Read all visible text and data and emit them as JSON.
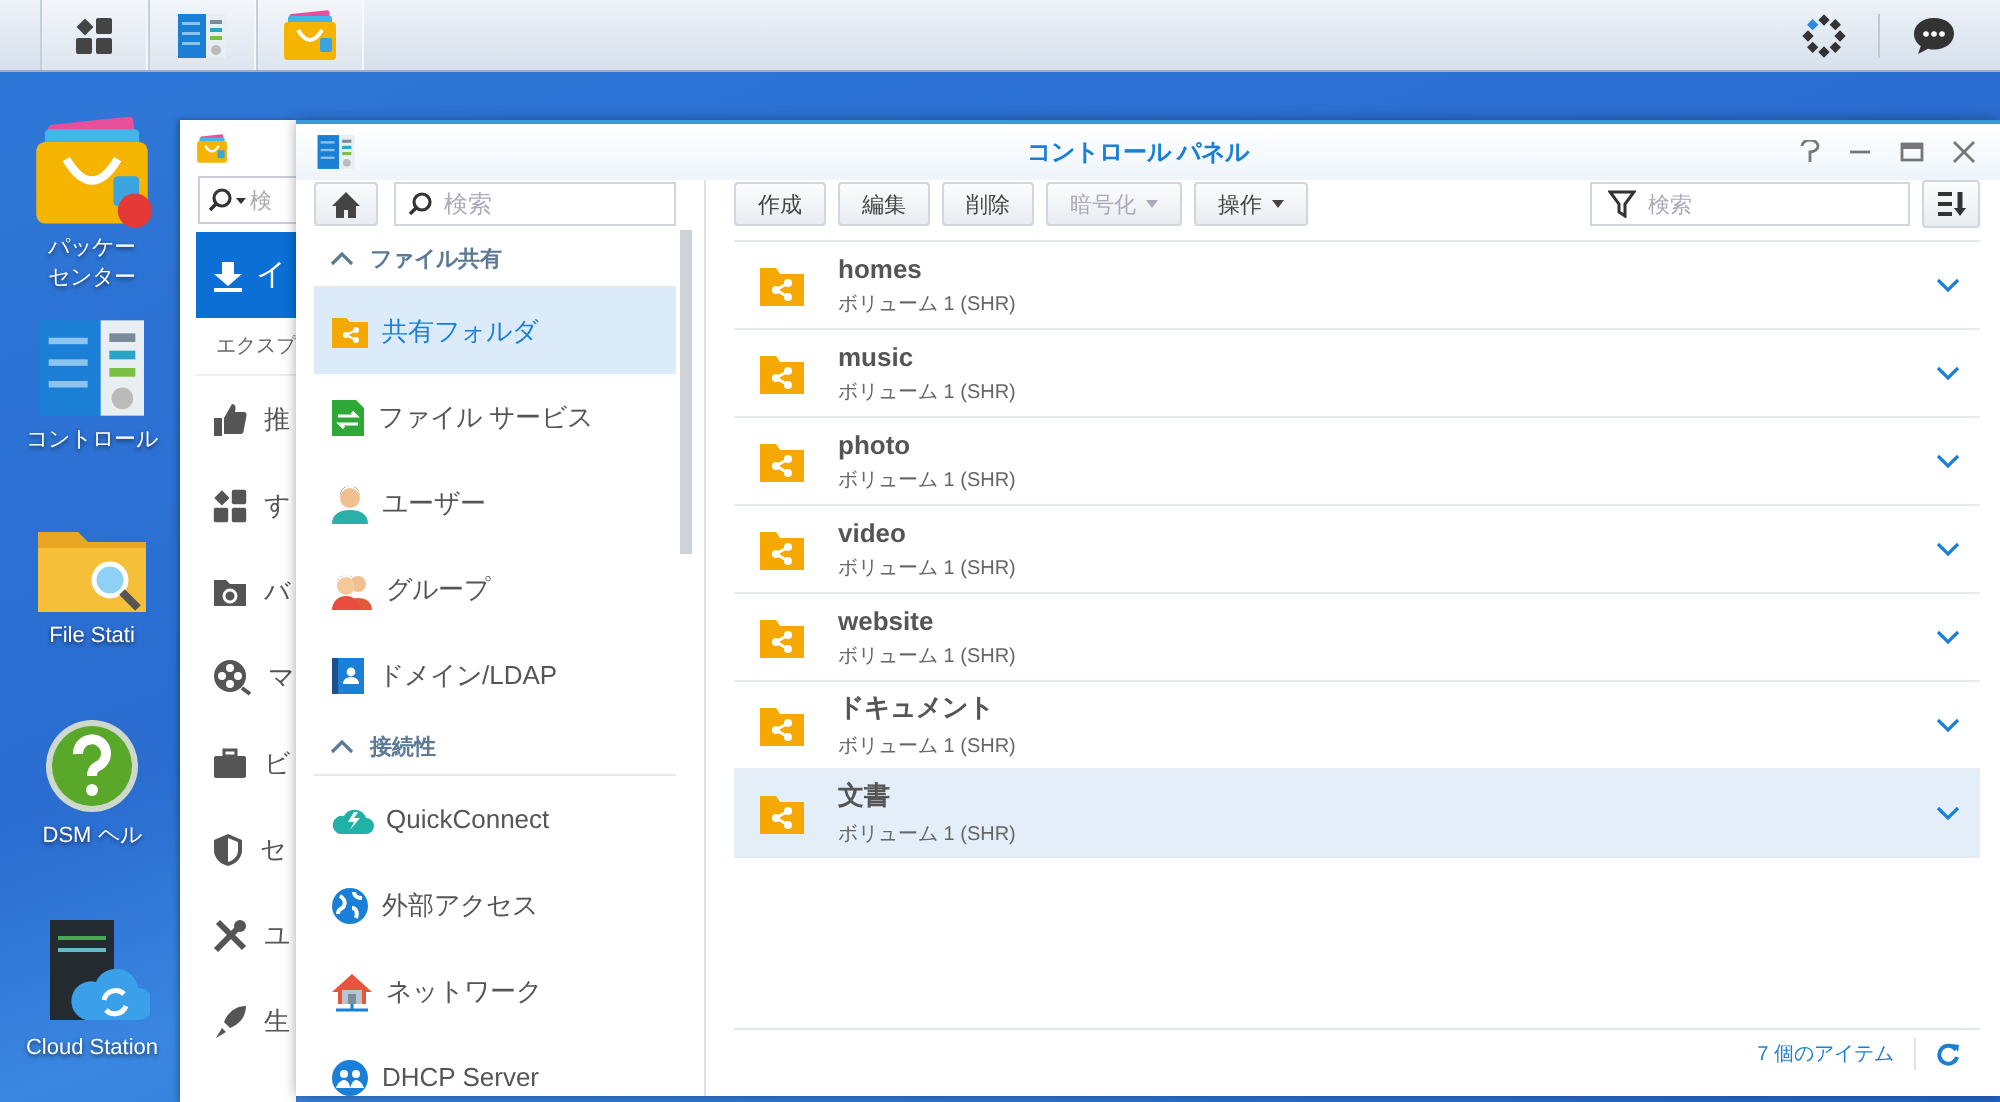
{
  "taskbar": {
    "apps": [
      {
        "kind": "main-menu"
      },
      {
        "kind": "control-panel"
      },
      {
        "kind": "package-center"
      }
    ]
  },
  "desktop_icons": [
    {
      "kind": "package-center",
      "label_lines": [
        "パッケー",
        "センター"
      ]
    },
    {
      "kind": "control-panel",
      "label_lines": [
        "コントロール"
      ]
    },
    {
      "kind": "file-station",
      "label_lines": [
        "File Stati"
      ]
    },
    {
      "kind": "dsm-help",
      "label_lines": [
        "DSM ヘル"
      ]
    },
    {
      "kind": "cloud-station",
      "label_lines": [
        "Cloud Station"
      ]
    }
  ],
  "package_center_window": {
    "search_placeholder": "検",
    "action_button": "イ",
    "section_title": "エクスプ",
    "items": [
      {
        "kind": "recommended",
        "label": "推"
      },
      {
        "kind": "all",
        "label": "す"
      },
      {
        "kind": "backup",
        "label": "バ"
      },
      {
        "kind": "multimedia",
        "label": "マ"
      },
      {
        "kind": "business",
        "label": "ビ"
      },
      {
        "kind": "security",
        "label": "セ"
      },
      {
        "kind": "utilities",
        "label": "ユ"
      },
      {
        "kind": "productivity",
        "label": "生"
      }
    ]
  },
  "control_panel": {
    "title": "コントロール パネル",
    "sidebar": {
      "search_placeholder": "検索",
      "groups": [
        {
          "title": "ファイル共有",
          "expanded": true,
          "items": [
            {
              "kind": "shared-folder",
              "label": "共有フォルダ",
              "selected": true
            },
            {
              "kind": "file-services",
              "label": "ファイル サービス",
              "selected": false
            },
            {
              "kind": "user",
              "label": "ユーザー",
              "selected": false
            },
            {
              "kind": "group",
              "label": "グループ",
              "selected": false
            },
            {
              "kind": "domain",
              "label": "ドメイン/LDAP",
              "selected": false
            }
          ]
        },
        {
          "title": "接続性",
          "expanded": true,
          "items": [
            {
              "kind": "quickconnect",
              "label": "QuickConnect",
              "selected": false
            },
            {
              "kind": "external-access",
              "label": "外部アクセス",
              "selected": false
            },
            {
              "kind": "network",
              "label": "ネットワーク",
              "selected": false
            },
            {
              "kind": "dhcp",
              "label": "DHCP Server",
              "selected": false
            }
          ]
        }
      ]
    },
    "toolbar": {
      "buttons": [
        {
          "label": "作成",
          "disabled": false,
          "dropdown": false
        },
        {
          "label": "編集",
          "disabled": false,
          "dropdown": false
        },
        {
          "label": "削除",
          "disabled": false,
          "dropdown": false
        },
        {
          "label": "暗号化",
          "disabled": true,
          "dropdown": true
        },
        {
          "label": "操作",
          "disabled": false,
          "dropdown": true
        }
      ],
      "filter_placeholder": "検索"
    },
    "rows": [
      {
        "name": "homes",
        "volume": "ボリューム 1 (SHR)",
        "selected": false
      },
      {
        "name": "music",
        "volume": "ボリューム 1 (SHR)",
        "selected": false
      },
      {
        "name": "photo",
        "volume": "ボリューム 1 (SHR)",
        "selected": false
      },
      {
        "name": "video",
        "volume": "ボリューム 1 (SHR)",
        "selected": false
      },
      {
        "name": "website",
        "volume": "ボリューム 1 (SHR)",
        "selected": false
      },
      {
        "name": "ドキュメント",
        "volume": "ボリューム 1 (SHR)",
        "selected": false
      },
      {
        "name": "文書",
        "volume": "ボリューム 1 (SHR)",
        "selected": true
      }
    ],
    "footer": {
      "count": "7 個のアイテム"
    }
  }
}
